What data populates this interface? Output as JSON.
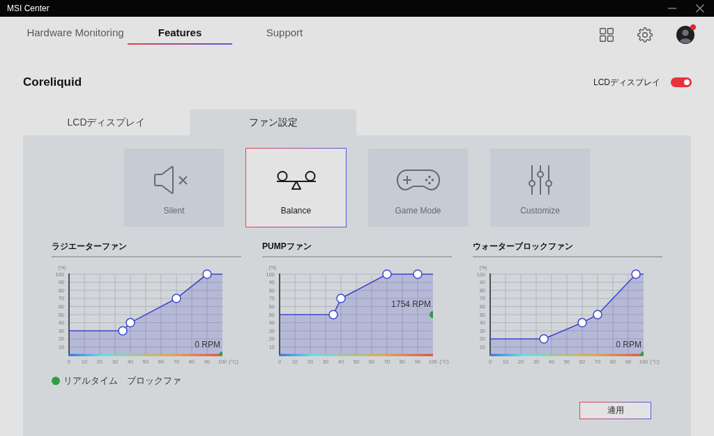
{
  "window": {
    "title": "MSI Center"
  },
  "nav": {
    "tabs": [
      {
        "label": "Hardware Monitoring",
        "selected": false
      },
      {
        "label": "Features",
        "selected": true
      },
      {
        "label": "Support",
        "selected": false
      }
    ],
    "avatar": {
      "notification": true
    }
  },
  "device": {
    "name": "Coreliquid",
    "lcd_toggle": {
      "label": "LCDディスプレイ",
      "on": true
    }
  },
  "sub_tabs": [
    {
      "label": "LCDディスプレイ",
      "selected": false
    },
    {
      "label": "ファン設定",
      "selected": true
    }
  ],
  "modes": [
    {
      "kind": "silent",
      "label": "Silent",
      "selected": false
    },
    {
      "kind": "balance",
      "label": "Balance",
      "selected": true
    },
    {
      "kind": "game",
      "label": "Game Mode",
      "selected": false
    },
    {
      "kind": "custom",
      "label": "Customize",
      "selected": false
    }
  ],
  "fans": [
    {
      "title": "ラジエーターファン",
      "realtime_indicator": {
        "level": 0
      },
      "chart_data": {
        "type": "area",
        "xlabel": "(°C)",
        "ylabel": "(%)",
        "x": [
          0,
          35,
          40,
          70,
          90,
          100
        ],
        "series": [
          {
            "color": "#3f48cc",
            "values": [
              30,
              30,
              40,
              70,
              100,
              100
            ]
          }
        ],
        "xlim": [
          0,
          100
        ],
        "ylim": [
          0,
          100
        ],
        "xticks": [
          0,
          10,
          20,
          30,
          40,
          50,
          60,
          70,
          80,
          90,
          100
        ],
        "yticks": [
          10,
          20,
          30,
          40,
          50,
          60,
          70,
          80,
          90,
          100
        ],
        "grid": true,
        "annotations": [
          "0 RPM"
        ]
      }
    },
    {
      "title": "PUMPファン",
      "realtime_indicator": {
        "level": 0.5
      },
      "chart_data": {
        "type": "area",
        "xlabel": "(°C)",
        "ylabel": "(%)",
        "x": [
          0,
          35,
          40,
          70,
          90,
          100
        ],
        "series": [
          {
            "color": "#3f48cc",
            "values": [
              50,
              50,
              70,
              100,
              100,
              100
            ]
          }
        ],
        "xlim": [
          0,
          100
        ],
        "ylim": [
          0,
          100
        ],
        "xticks": [
          0,
          10,
          20,
          30,
          40,
          50,
          60,
          70,
          80,
          90,
          100
        ],
        "yticks": [
          10,
          20,
          30,
          40,
          50,
          60,
          70,
          80,
          90,
          100
        ],
        "grid": true,
        "annotations": [
          "1754 RPM"
        ]
      }
    },
    {
      "title": "ウォーターブロックファン",
      "realtime_indicator": {
        "level": 0
      },
      "chart_data": {
        "type": "area",
        "xlabel": "(°C)",
        "ylabel": "(%)",
        "x": [
          0,
          35,
          60,
          70,
          95,
          100
        ],
        "series": [
          {
            "color": "#3f48cc",
            "values": [
              20,
              20,
              40,
              50,
              100,
              100
            ]
          }
        ],
        "xlim": [
          0,
          100
        ],
        "ylim": [
          0,
          100
        ],
        "xticks": [
          0,
          10,
          20,
          30,
          40,
          50,
          60,
          70,
          80,
          90,
          100
        ],
        "yticks": [
          10,
          20,
          30,
          40,
          50,
          60,
          70,
          80,
          90,
          100
        ],
        "grid": true,
        "annotations": [
          "0 RPM"
        ]
      }
    }
  ],
  "legend": {
    "color": "#2ea043",
    "label": "リアルタイム　ブロックファ"
  },
  "apply_button": {
    "label": "適用"
  }
}
